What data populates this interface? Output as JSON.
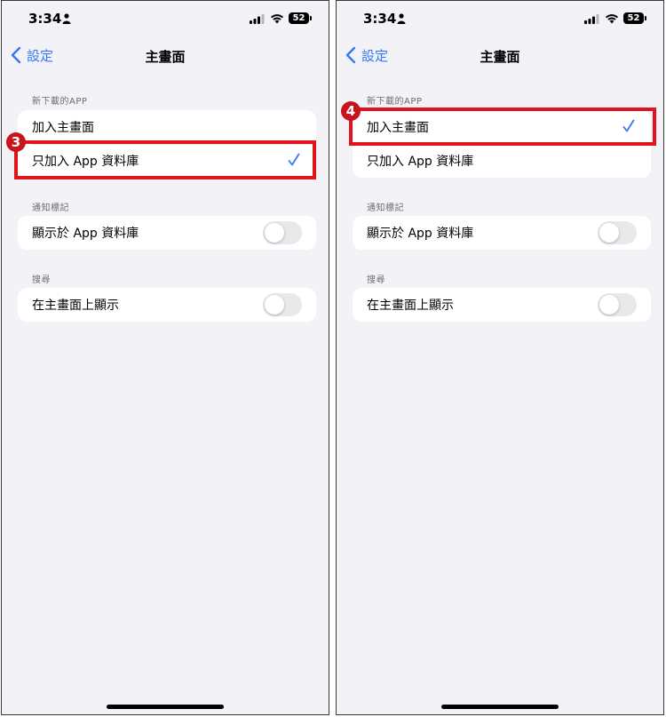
{
  "status": {
    "time": "3:34",
    "battery": "52"
  },
  "nav": {
    "back_label": "設定",
    "title": "主畫面"
  },
  "sections": {
    "new_apps": {
      "label": "新下載的APP",
      "option_home": "加入主畫面",
      "option_library": "只加入 App 資料庫"
    },
    "badges": {
      "label": "通知標記",
      "row_label": "顯示於 App 資料庫"
    },
    "search": {
      "label": "搜尋",
      "row_label": "在主畫面上顯示"
    }
  },
  "steps": {
    "left": "3",
    "right": "4"
  },
  "colors": {
    "accent": "#3478f6",
    "highlight": "#e0141c",
    "badge": "#c8141c",
    "background": "#f2f2f7"
  }
}
